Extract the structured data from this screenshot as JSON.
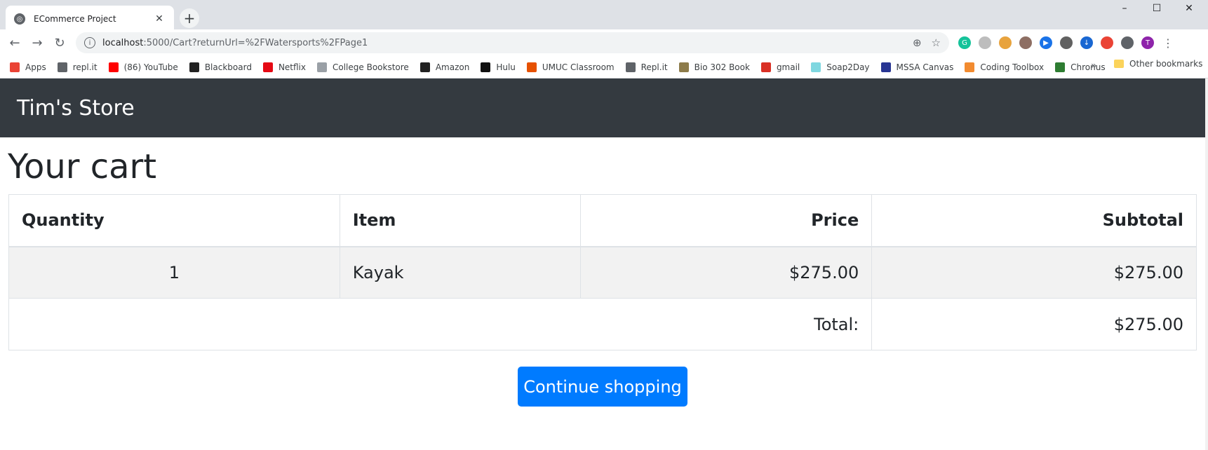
{
  "browser": {
    "tab_title": "ECommerce Project",
    "tab_close": "✕",
    "new_tab": "+",
    "window_controls": {
      "minimize": "–",
      "maximize": "☐",
      "close": "✕"
    },
    "nav": {
      "back": "←",
      "forward": "→",
      "reload": "↻"
    },
    "url_host": "localhost",
    "url_rest": ":5000/Cart?returnUrl=%2FWatersports%2FPage1",
    "info_icon": "i",
    "zoom_icon": "⊕",
    "star_icon": "☆",
    "extensions": [
      {
        "name": "grammarly",
        "color": "#15c39a",
        "glyph": "G"
      },
      {
        "name": "extension-gray",
        "color": "#bdbdbd",
        "glyph": ""
      },
      {
        "name": "extension-multicolor",
        "color": "#e8a33d",
        "glyph": ""
      },
      {
        "name": "extension-faces",
        "color": "#8d6e63",
        "glyph": ""
      },
      {
        "name": "extension-play",
        "color": "#1a73e8",
        "glyph": "▶"
      },
      {
        "name": "extension-circles",
        "color": "#616161",
        "glyph": ""
      },
      {
        "name": "extension-download",
        "color": "#1967d2",
        "glyph": "↓"
      },
      {
        "name": "extension-red",
        "color": "#ea4335",
        "glyph": ""
      },
      {
        "name": "extension-puzzle",
        "color": "#5f6368",
        "glyph": ""
      },
      {
        "name": "profile-avatar",
        "color": "#8e24aa",
        "glyph": "T"
      },
      {
        "name": "menu",
        "color": "#ffffff",
        "glyph": "⋮"
      }
    ],
    "bookmarks": [
      {
        "label": "Apps",
        "color": "#ea4335"
      },
      {
        "label": "repl.it",
        "color": "#5f6368"
      },
      {
        "label": "(86) YouTube",
        "color": "#ff0000"
      },
      {
        "label": "Blackboard",
        "color": "#222222"
      },
      {
        "label": "Netflix",
        "color": "#e50914"
      },
      {
        "label": "College Bookstore",
        "color": "#9aa0a6"
      },
      {
        "label": "Amazon",
        "color": "#222222"
      },
      {
        "label": "Hulu",
        "color": "#111111"
      },
      {
        "label": "UMUC Classroom",
        "color": "#e65100"
      },
      {
        "label": "Repl.it",
        "color": "#5f6368"
      },
      {
        "label": "Bio 302 Book",
        "color": "#8d7b4a"
      },
      {
        "label": "gmail",
        "color": "#d93025"
      },
      {
        "label": "Soap2Day",
        "color": "#7fd7e0"
      },
      {
        "label": "MSSA Canvas",
        "color": "#283593"
      },
      {
        "label": "Coding Toolbox",
        "color": "#f28b30"
      },
      {
        "label": "Chronus",
        "color": "#2e7d32"
      }
    ],
    "bookmarks_more": "»",
    "other_bookmarks": "Other bookmarks"
  },
  "page": {
    "brand": "Tim's Store",
    "heading": "Your cart",
    "table": {
      "headers": {
        "quantity": "Quantity",
        "item": "Item",
        "price": "Price",
        "subtotal": "Subtotal"
      },
      "rows": [
        {
          "quantity": "1",
          "item": "Kayak",
          "price": "$275.00",
          "subtotal": "$275.00"
        }
      ],
      "total_label": "Total:",
      "total_value": "$275.00"
    },
    "continue_button": "Continue shopping"
  },
  "colors": {
    "navbar": "#343a40",
    "button": "#007bff",
    "row_stripe": "#f2f2f2"
  }
}
